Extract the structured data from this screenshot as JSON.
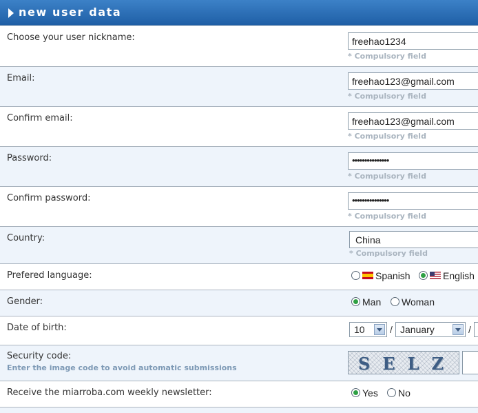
{
  "header": {
    "title": "new user data"
  },
  "form": {
    "compulsory": "* Compulsory field",
    "nickname": {
      "label": "Choose your user nickname:",
      "value": "freehao1234"
    },
    "email": {
      "label": "Email:",
      "value": "freehao123@gmail.com"
    },
    "confirm_email": {
      "label": "Confirm email:",
      "value": "freehao123@gmail.com"
    },
    "password": {
      "label": "Password:",
      "value": "•••••••••••••••"
    },
    "confirm_password": {
      "label": "Confirm password:",
      "value": "•••••••••••••••"
    },
    "country": {
      "label": "Country:",
      "value": "China"
    },
    "language": {
      "label": "Prefered language:",
      "options": [
        {
          "label": "Spanish",
          "selected": false,
          "flag": "spain-flag-icon"
        },
        {
          "label": "English",
          "selected": true,
          "flag": "usa-flag-icon"
        }
      ]
    },
    "gender": {
      "label": "Gender:",
      "options": [
        {
          "label": "Man",
          "selected": true
        },
        {
          "label": "Woman",
          "selected": false
        }
      ]
    },
    "dob": {
      "label": "Date of birth:",
      "day": "10",
      "month": "January",
      "separator": "/"
    },
    "security": {
      "label": "Security code:",
      "hint": "Enter the image code to avoid automatic submissions",
      "captcha_text": "SELZ"
    },
    "newsletter": {
      "label": "Receive the miarroba.com weekly newsletter:",
      "options": [
        {
          "label": "Yes",
          "selected": true
        },
        {
          "label": "No",
          "selected": false
        }
      ]
    }
  },
  "colors": {
    "header": "#2a6db4",
    "row_alt": "#eef4fb",
    "note": "#a9b4bf",
    "radio_selected": "#2ea043"
  }
}
